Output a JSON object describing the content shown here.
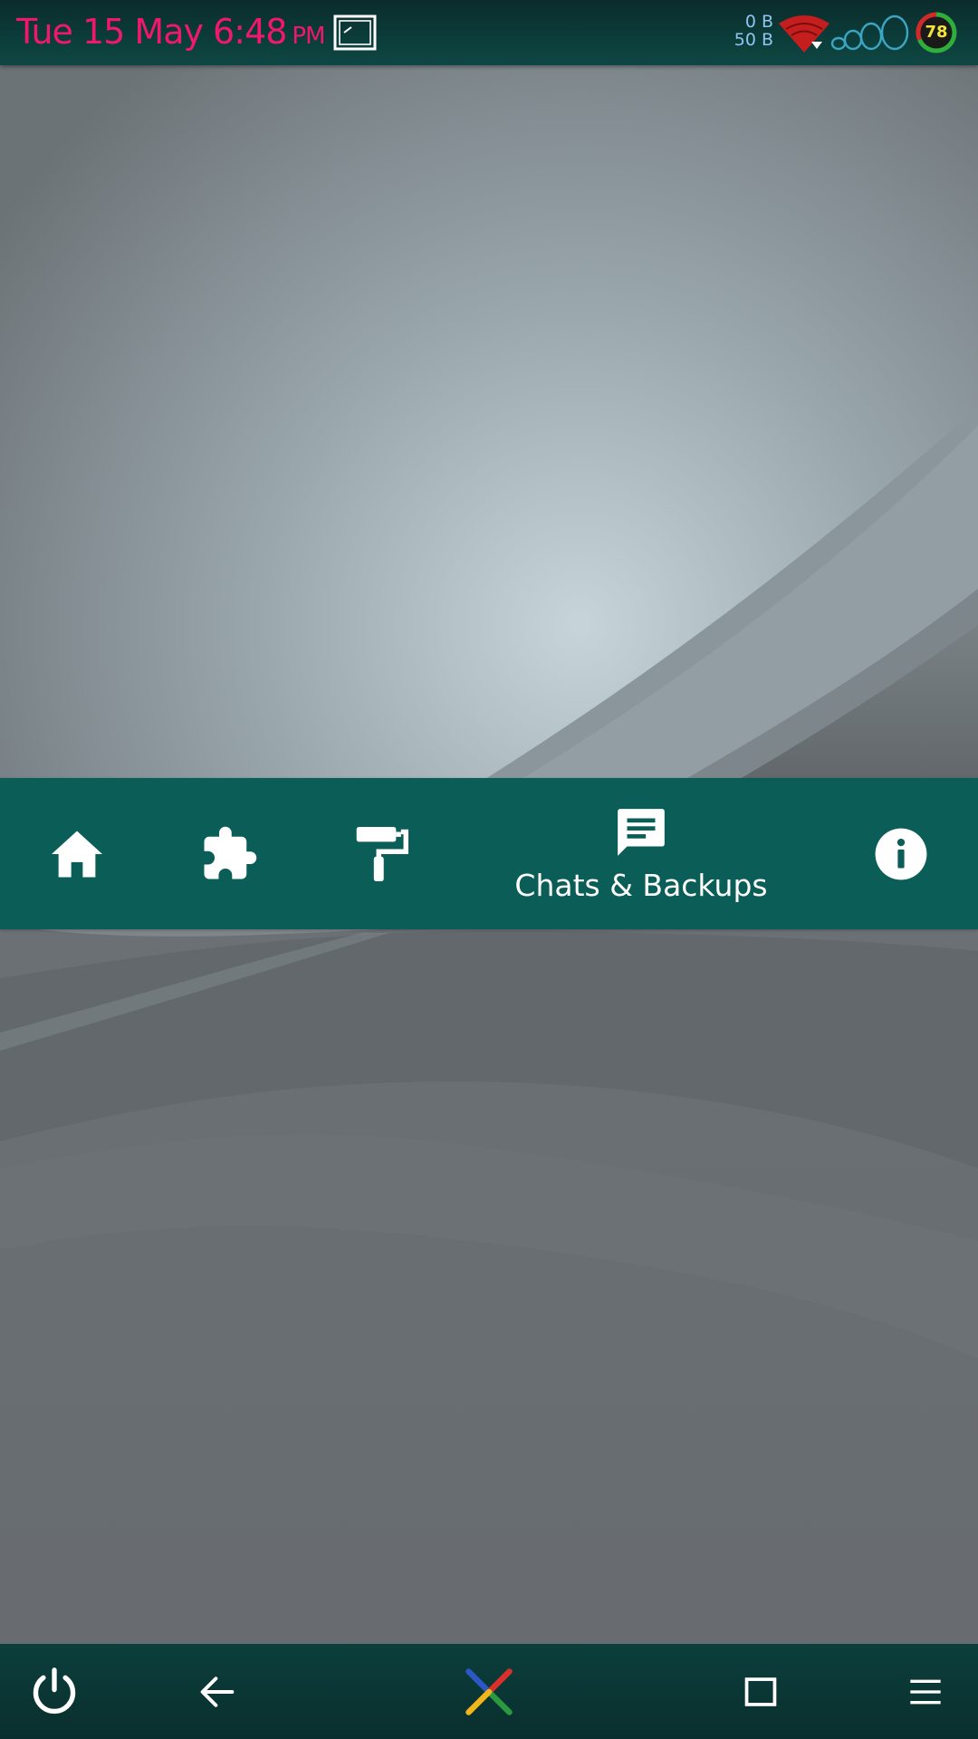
{
  "status_bar": {
    "clock": "Tue 15 May 6:48",
    "ampm": "PM",
    "net_down": "0 B",
    "net_up": "50 B",
    "battery": "78"
  },
  "toolbar": {
    "active_tab_label": "Chats & Backups",
    "items": [
      {
        "id": "home",
        "icon": "home-icon"
      },
      {
        "id": "mods",
        "icon": "puzzle-piece-icon"
      },
      {
        "id": "themes",
        "icon": "paint-roller-icon"
      },
      {
        "id": "chats",
        "icon": "chat-message-icon"
      },
      {
        "id": "info",
        "icon": "info-icon"
      }
    ]
  },
  "system_nav": {
    "items": [
      "power-icon",
      "back-arrow-icon",
      "pinwheel-home-icon",
      "recents-square-icon",
      "menu-icon"
    ]
  },
  "colors": {
    "clock": "#f0186a",
    "toolbar": "#0a5e57",
    "status_bar": "#0b3d3a",
    "net_speed": "#8fc4f0",
    "battery_text": "#f2e23a"
  }
}
